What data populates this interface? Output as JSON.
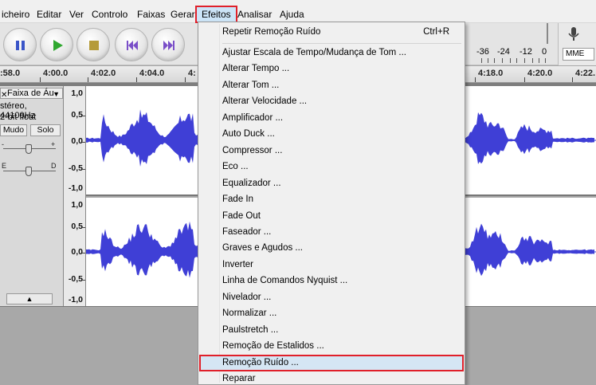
{
  "menubar": {
    "items": [
      "icheiro",
      "Editar",
      "Ver",
      "Controlo",
      "Faixas",
      "Gerar",
      "Efeitos",
      "Analisar",
      "Ajuda"
    ],
    "active_index": 6
  },
  "toolbar": {
    "buttons": [
      "pause-icon",
      "play-icon",
      "stop-icon",
      "skip-start-icon",
      "skip-end-icon"
    ],
    "meter_labels": [
      "-36",
      "-24",
      "-12",
      "0"
    ],
    "device": "MME"
  },
  "ruler": {
    "labels": [
      ":58.0",
      "4:00.0",
      "4:02.0",
      "4:04.0",
      "4:",
      "4:18.0",
      "4:20.0",
      "4:22."
    ]
  },
  "track": {
    "name": "Faixa de Áu",
    "info_line1": "stéreo, 44100Hz",
    "info_line2": "2-bit float",
    "mute_label": "Mudo",
    "solo_label": "Solo",
    "gain_minus": "-",
    "gain_plus": "+",
    "pan_left": "E",
    "pan_right": "D",
    "collapse_glyph": "▲",
    "close_glyph": "✕",
    "menu_glyph": "▼"
  },
  "scale": {
    "labels": [
      "1,0",
      "0,5",
      "0,0",
      "-0,5",
      "-1,0"
    ]
  },
  "effects_menu": {
    "repeat_label": "Repetir Remoção Ruído",
    "repeat_shortcut": "Ctrl+R",
    "items": [
      "Ajustar Escala de Tempo/Mudança de Tom ...",
      "Alterar Tempo ...",
      "Alterar Tom ...",
      "Alterar Velocidade ...",
      "Amplificador ...",
      "Auto Duck ...",
      "Compressor ...",
      "Eco ...",
      "Equalizador ...",
      "Fade In",
      "Fade Out",
      "Faseador ...",
      "Graves e Agudos ...",
      "Inverter",
      "Linha de Comandos Nyquist ...",
      "Nivelador ...",
      "Normalizar ...",
      "Paulstretch ...",
      "Remoção de Estalidos ...",
      "Remoção Ruído ...",
      "Reparar"
    ],
    "highlighted_index": 19
  },
  "colors": {
    "waveform": "#3f3fd6",
    "highlight_border": "#e0202a",
    "menu_highlight": "#d5e6f4"
  }
}
